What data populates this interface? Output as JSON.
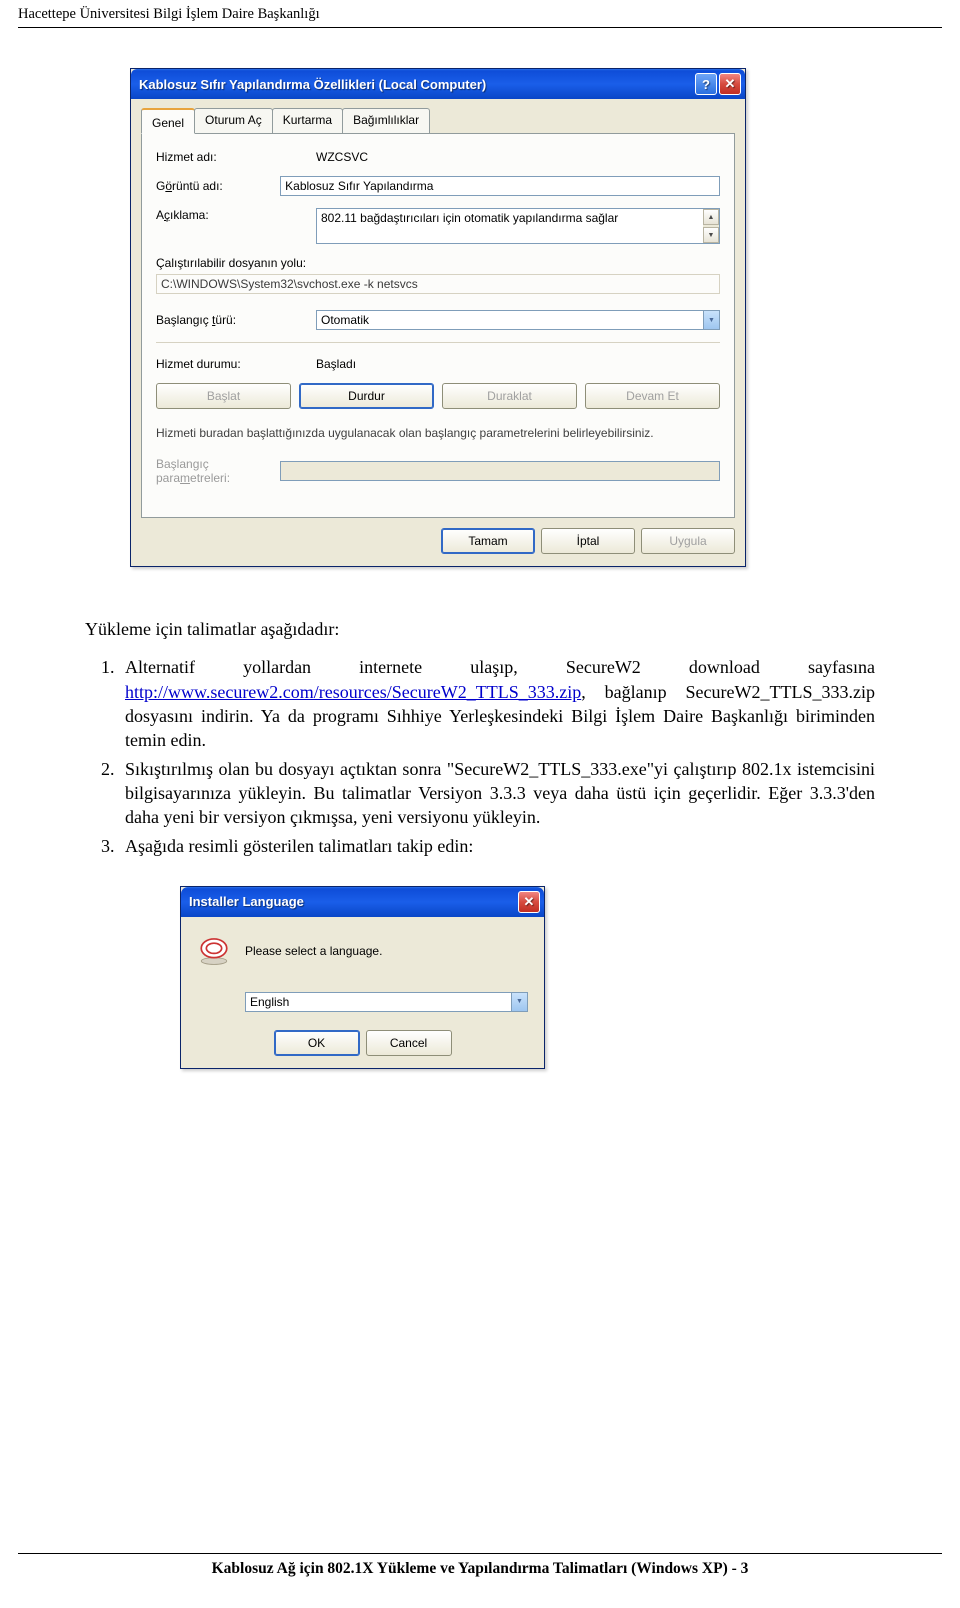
{
  "header": {
    "text": "Hacettepe Üniversitesi Bilgi İşlem Daire Başkanlığı"
  },
  "dialog1": {
    "title": "Kablosuz Sıfır Yapılandırma Özellikleri (Local Computer)",
    "help_glyph": "?",
    "close_glyph": "✕",
    "tabs": {
      "genel": "Genel",
      "oturum": "Oturum Aç",
      "kurtarma": "Kurtarma",
      "bagimlilik": "Bağımlılıklar"
    },
    "labels": {
      "hizmet_adi": "Hizmet adı:",
      "goruntu_adi_pre": "G",
      "goruntu_adi_ul": "ö",
      "goruntu_adi_post": "rüntü adı:",
      "aciklama_pre": "A",
      "aciklama_ul": "ç",
      "aciklama_post": "ıklama:",
      "yol_pre": "",
      "yol_ul": "Ç",
      "yol_post": "alıştırılabilir dosyanın yolu:",
      "baslangic_pre": "Başlangıç ",
      "baslangic_ul": "t",
      "baslangic_post": "ürü:",
      "durum": "Hizmet durumu:",
      "param_pre": "Başlangıç para",
      "param_ul": "m",
      "param_post": "etreleri:"
    },
    "values": {
      "hizmet_adi": "WZCSVC",
      "goruntu_adi": "Kablosuz Sıfır Yapılandırma",
      "aciklama": "802.11 bağdaştırıcıları için otomatik yapılandırma sağlar",
      "yol": "C:\\WINDOWS\\System32\\svchost.exe -k netsvcs",
      "baslangic": "Otomatik",
      "durum": "Başladı",
      "param": ""
    },
    "desc": "Hizmeti buradan başlattığınızda uygulanacak olan başlangıç parametrelerini belirleyebilirsiniz.",
    "buttons": {
      "baslat": "Başlat",
      "durdur": "Durdur",
      "duraklat": "Duraklat",
      "devam": "Devam Et",
      "tamam": "Tamam",
      "iptal": "İptal",
      "uygula": "Uygula"
    }
  },
  "doc": {
    "intro": "Yükleme için talimatlar aşağıdadır:",
    "item1_a": "Alternatif yollardan internete ulaşıp, SecureW2 download sayfasına ",
    "item1_link": "http://www.securew2.com/resources/SecureW2_TTLS_333.zip",
    "item1_b": ", bağlanıp SecureW2_TTLS_333.zip dosyasını indirin. Ya da programı Sıhhiye Yerleşkesindeki Bilgi İşlem Daire Başkanlığı biriminden temin edin.",
    "item2": "Sıkıştırılmış olan bu dosyayı açtıktan sonra \"SecureW2_TTLS_333.exe\"yi çalıştırıp 802.1x istemcisini bilgisayarınıza yükleyin. Bu talimatlar Versiyon 3.3.3 veya daha üstü için geçerlidir. Eğer 3.3.3'den daha yeni bir versiyon çıkmışsa, yeni versiyonu yükleyin.",
    "item3": "Aşağıda resimli gösterilen talimatları takip edin:"
  },
  "dialog2": {
    "title": "Installer Language",
    "close_glyph": "✕",
    "message": "Please select a language.",
    "language": "English",
    "buttons": {
      "ok": "OK",
      "cancel": "Cancel"
    }
  },
  "footer": {
    "text": "Kablosuz Ağ için 802.1X Yükleme ve Yapılandırma Talimatları (Windows XP) - 3"
  }
}
